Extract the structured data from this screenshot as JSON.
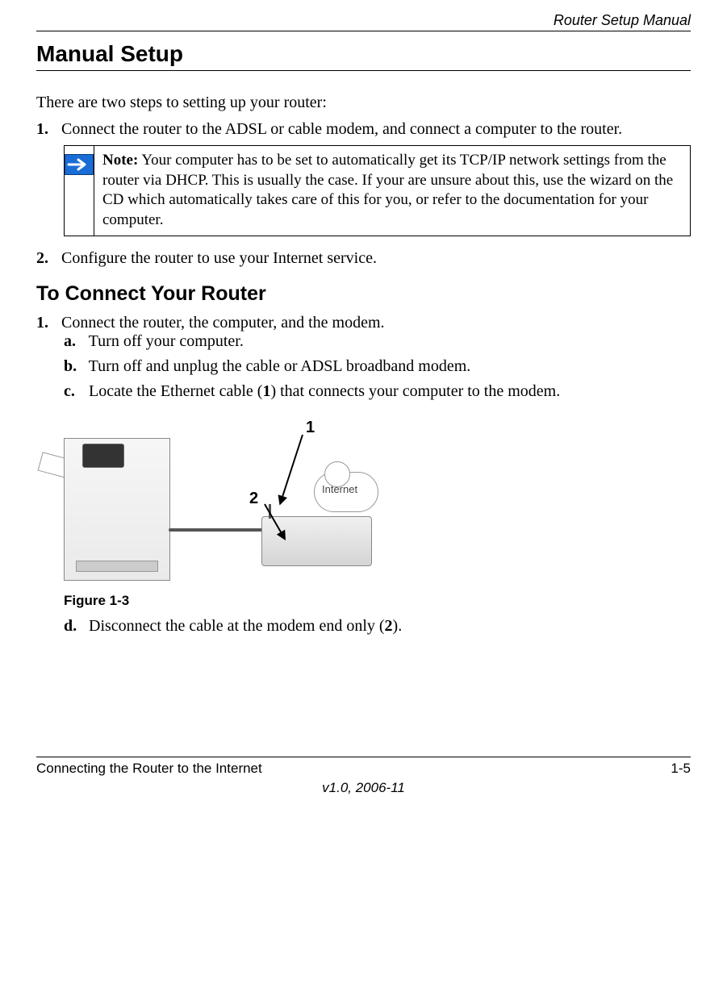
{
  "header": {
    "doc_title": "Router Setup Manual"
  },
  "section": {
    "title": "Manual Setup",
    "intro": "There are two steps to setting up your router:",
    "steps": [
      {
        "marker": "1.",
        "text": "Connect the router to the ADSL or cable modem, and connect a computer to the router."
      },
      {
        "marker": "2.",
        "text": "Configure the router to use your Internet service."
      }
    ],
    "note": {
      "label": "Note:",
      "text": " Your computer has to be set to automatically get its TCP/IP network settings from the router via DHCP. This is usually the case. If your are unsure about this, use the wizard on the CD which automatically takes care of this for you, or refer to the documentation for your computer."
    }
  },
  "subsection": {
    "title": "To Connect Your Router",
    "step1": {
      "marker": "1.",
      "text": "Connect the router, the computer, and the modem.",
      "sub": [
        {
          "marker": "a.",
          "text": "Turn off your computer."
        },
        {
          "marker": "b.",
          "text": "Turn off and unplug the cable or ADSL broadband modem."
        },
        {
          "marker": "c.",
          "text_pre": "Locate the Ethernet cable (",
          "bold": "1",
          "text_post": ") that connects your computer to the modem."
        },
        {
          "marker": "d.",
          "text_pre": "Disconnect the cable at the modem end only (",
          "bold": "2",
          "text_post": ")."
        }
      ]
    },
    "figure": {
      "callout1": "1",
      "callout2": "2",
      "cloud": "Internet",
      "caption": "Figure 1-3"
    }
  },
  "footer": {
    "left": "Connecting the Router to the Internet",
    "right": "1-5",
    "version": "v1.0, 2006-11"
  }
}
